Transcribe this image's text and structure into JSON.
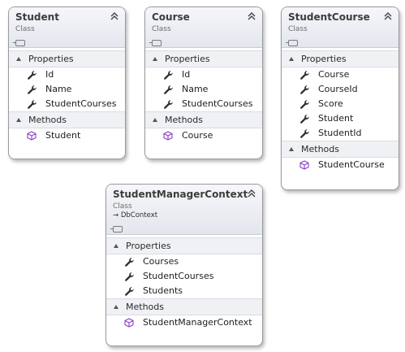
{
  "classes": [
    {
      "name": "Student",
      "stereotype": "Class",
      "base": "",
      "properties_label": "Properties",
      "methods_label": "Methods",
      "properties": [
        "Id",
        "Name",
        "StudentCourses"
      ],
      "methods": [
        "Student"
      ]
    },
    {
      "name": "Course",
      "stereotype": "Class",
      "base": "",
      "properties_label": "Properties",
      "methods_label": "Methods",
      "properties": [
        "Id",
        "Name",
        "StudentCourses"
      ],
      "methods": [
        "Course"
      ]
    },
    {
      "name": "StudentCourse",
      "stereotype": "Class",
      "base": "",
      "properties_label": "Properties",
      "methods_label": "Methods",
      "properties": [
        "Course",
        "CourseId",
        "Score",
        "Student",
        "StudentId"
      ],
      "methods": [
        "StudentCourse"
      ]
    },
    {
      "name": "StudentManagerContext",
      "stereotype": "Class",
      "base": "DbContext",
      "properties_label": "Properties",
      "methods_label": "Methods",
      "properties": [
        "Courses",
        "StudentCourses",
        "Students"
      ],
      "methods": [
        "StudentManagerContext"
      ]
    }
  ],
  "icons": {
    "property": "wrench-icon",
    "method": "cube-icon",
    "collapse": "double-chevron-up-icon",
    "inherits": "arrow-right-icon"
  },
  "colors": {
    "method_icon": "#8a3fc4",
    "header_bg": "#e3e6ed",
    "border": "#9a9a9a"
  }
}
